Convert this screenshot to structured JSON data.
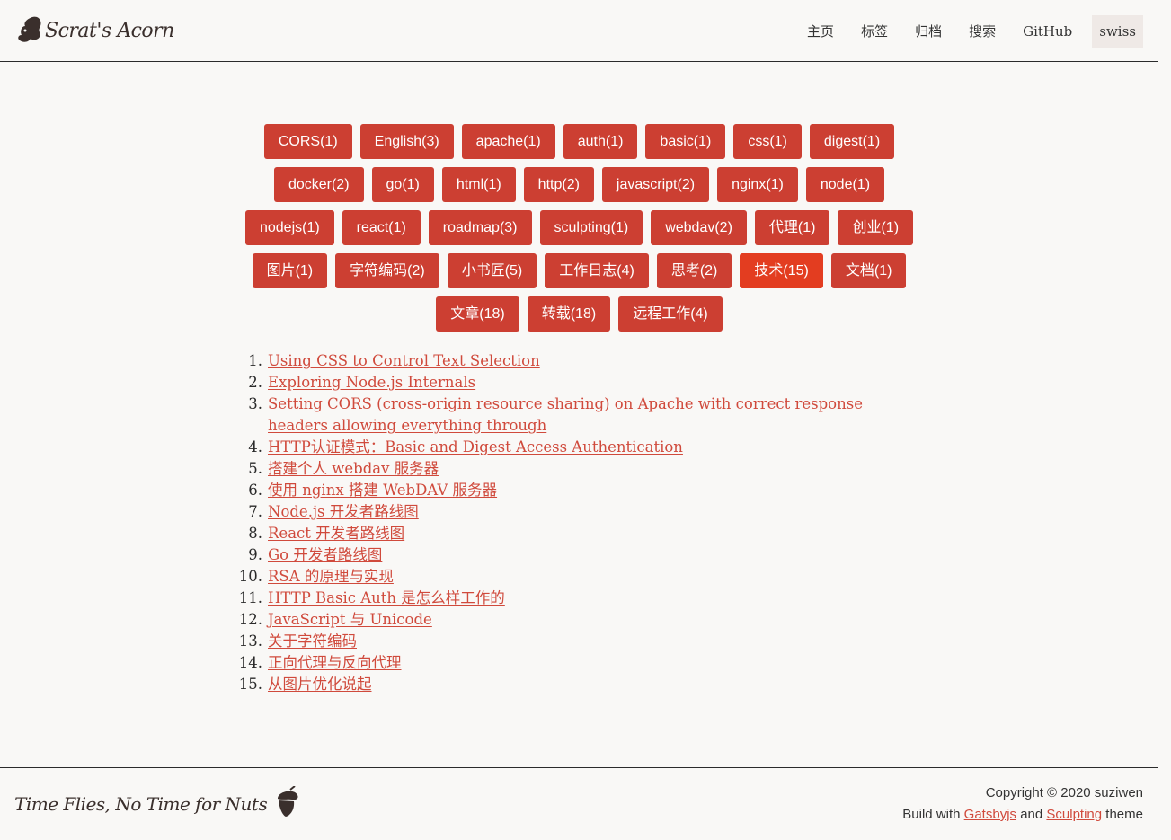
{
  "header": {
    "logo_text": "Scrat's Acorn",
    "nav": [
      {
        "label": "主页"
      },
      {
        "label": "标签"
      },
      {
        "label": "归档"
      },
      {
        "label": "搜索"
      },
      {
        "label": "GitHub"
      },
      {
        "label": "swiss"
      }
    ]
  },
  "tags": [
    {
      "label": "CORS(1)"
    },
    {
      "label": "English(3)"
    },
    {
      "label": "apache(1)"
    },
    {
      "label": "auth(1)"
    },
    {
      "label": "basic(1)"
    },
    {
      "label": "css(1)"
    },
    {
      "label": "digest(1)"
    },
    {
      "label": "docker(2)"
    },
    {
      "label": "go(1)"
    },
    {
      "label": "html(1)"
    },
    {
      "label": "http(2)"
    },
    {
      "label": "javascript(2)"
    },
    {
      "label": "nginx(1)"
    },
    {
      "label": "node(1)"
    },
    {
      "label": "nodejs(1)"
    },
    {
      "label": "react(1)"
    },
    {
      "label": "roadmap(3)"
    },
    {
      "label": "sculpting(1)"
    },
    {
      "label": "webdav(2)"
    },
    {
      "label": "代理(1)"
    },
    {
      "label": "创业(1)"
    },
    {
      "label": "图片(1)"
    },
    {
      "label": "字符编码(2)"
    },
    {
      "label": "小书匠(5)"
    },
    {
      "label": "工作日志(4)"
    },
    {
      "label": "思考(2)"
    },
    {
      "label": "技术(15)"
    },
    {
      "label": "文档(1)"
    },
    {
      "label": "文章(18)"
    },
    {
      "label": "转载(18)"
    },
    {
      "label": "远程工作(4)"
    }
  ],
  "posts": [
    "Using CSS to Control Text Selection",
    "Exploring Node.js Internals",
    "Setting CORS (cross-origin resource sharing) on Apache with correct response headers allowing everything through",
    "HTTP认证模式：Basic and Digest Access Authentication",
    "搭建个人 webdav 服务器",
    "使用 nginx 搭建 WebDAV 服务器",
    "Node.js 开发者路线图",
    "React 开发者路线图",
    "Go 开发者路线图",
    "RSA 的原理与实现",
    "HTTP Basic Auth 是怎么样工作的",
    "JavaScript 与 Unicode",
    "关于字符编码",
    "正向代理与反向代理",
    "从图片优化说起"
  ],
  "footer": {
    "slogan": "Time Flies, No Time for Nuts",
    "copyright": "Copyright © 2020 suziwen",
    "build_with": "Build with",
    "gatsby": "Gatsbyjs",
    "and": "and",
    "sculpting": "Sculpting",
    "theme": "theme"
  },
  "colors": {
    "accent": "#cc3f32",
    "active_tag": "#e33d20",
    "link": "#d04a3c",
    "background": "#f9f8f6"
  }
}
